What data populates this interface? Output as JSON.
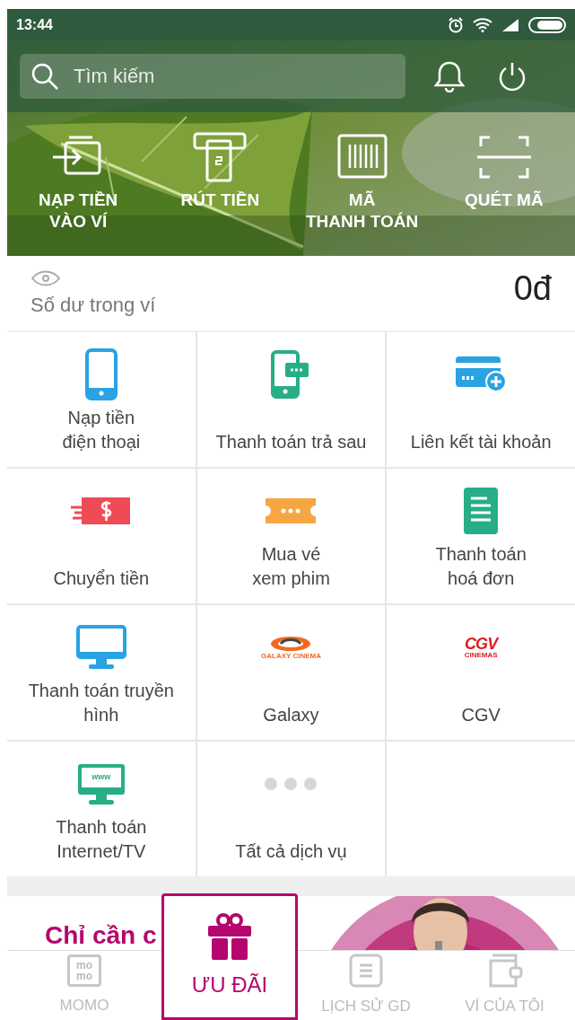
{
  "status_bar": {
    "time": "13:44"
  },
  "search": {
    "placeholder": "Tìm kiếm"
  },
  "quick_actions": [
    {
      "label": "NẠP TIỀN\nVÀO VÍ"
    },
    {
      "label": "RÚT TIỀN"
    },
    {
      "label": "MÃ\nTHANH TOÁN"
    },
    {
      "label": "QUÉT MÃ"
    }
  ],
  "balance": {
    "label": "Số dư trong ví",
    "amount": "0đ"
  },
  "services": [
    {
      "label": "Nạp tiền\nđiện thoại"
    },
    {
      "label": "Thanh toán trả sau"
    },
    {
      "label": "Liên kết tài khoản"
    },
    {
      "label": "Chuyển tiền"
    },
    {
      "label": "Mua vé\nxem phim"
    },
    {
      "label": "Thanh toán\nhoá đơn"
    },
    {
      "label": "Thanh toán truyền hình"
    },
    {
      "label": "Galaxy",
      "logo": "GALAXY CINEMA"
    },
    {
      "label": "CGV",
      "logo": "CGV",
      "logo_sub": "CINEMAS"
    },
    {
      "label": "Thanh toán\nInternet/TV",
      "icon_text": "www"
    },
    {
      "label": "Tất cả dịch vụ"
    }
  ],
  "promo_banner": {
    "headline": "Chỉ cần c"
  },
  "bottom_nav": [
    {
      "label": "MOMO",
      "icon_text": [
        "mo",
        "mo"
      ],
      "selected": false
    },
    {
      "label": "ƯU ĐÃI",
      "selected": true
    },
    {
      "label": "LỊCH SỬ GD",
      "selected": false
    },
    {
      "label": "VÍ CỦA TÔI",
      "selected": false
    }
  ]
}
